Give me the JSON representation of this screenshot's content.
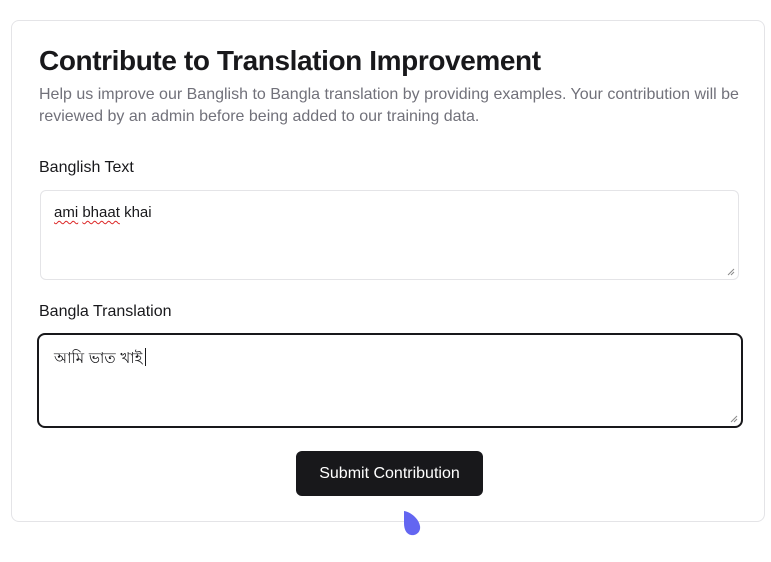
{
  "form": {
    "title": "Contribute to Translation Improvement",
    "description": "Help us improve our Banglish to Bangla translation by providing examples. Your contribution will be reviewed by an admin before being added to our training data.",
    "banglish_label": "Banglish Text",
    "banglish_value_words": [
      "ami",
      "bhaat",
      "khai"
    ],
    "bangla_label": "Bangla Translation",
    "bangla_value": "আমি ভাত খাই",
    "submit_label": "Submit Contribution"
  },
  "colors": {
    "accent": "#18181b",
    "cursor": "#6366f1",
    "spellcheck": "#dc2626"
  },
  "icons": {
    "resize": "resize-grip-icon",
    "pointer": "mouse-pointer-icon"
  }
}
